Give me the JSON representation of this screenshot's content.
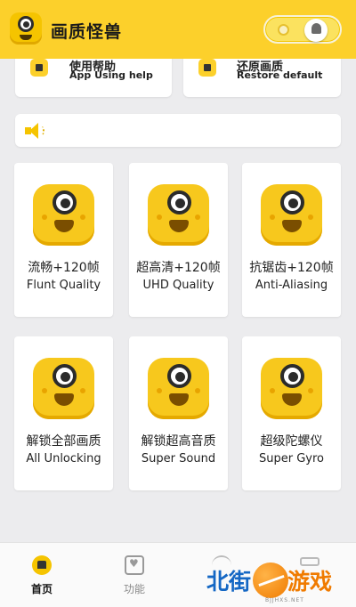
{
  "header": {
    "app_title": "画质怪兽",
    "theme_toggle": {
      "state": "light",
      "left_icon": "sun-icon",
      "right_icon": "moon-icon"
    }
  },
  "top_cards": [
    {
      "title": "使用帮助",
      "subtitle": "App Using help",
      "icon": "help-icon"
    },
    {
      "title": "还原画质",
      "subtitle": "Restore default",
      "icon": "restore-icon"
    }
  ],
  "notice": {
    "icon": "speaker-icon",
    "text": ""
  },
  "features": [
    {
      "title": "流畅+120帧",
      "subtitle": "Flunt Quality"
    },
    {
      "title": "超高清+120帧",
      "subtitle": "UHD Quality"
    },
    {
      "title": "抗锯齿+120帧",
      "subtitle": "Anti-Aliasing"
    },
    {
      "title": "解锁全部画质",
      "subtitle": "All Unlocking"
    },
    {
      "title": "解锁超高音质",
      "subtitle": "Super Sound"
    },
    {
      "title": "超级陀螺仪",
      "subtitle": "Super Gyro"
    }
  ],
  "bottom_nav": [
    {
      "label": "首页",
      "icon": "home-icon",
      "active": true
    },
    {
      "label": "功能",
      "icon": "function-icon",
      "active": false
    },
    {
      "label": "",
      "icon": "nav-icon-3",
      "active": false
    },
    {
      "label": "",
      "icon": "nav-icon-4",
      "active": false
    }
  ],
  "watermark": {
    "text_left": "北街",
    "text_right": "游戏",
    "url": "BJJHXS.NET"
  },
  "colors": {
    "brand_yellow": "#fcd02b",
    "background": "#ececee",
    "card": "#ffffff"
  }
}
